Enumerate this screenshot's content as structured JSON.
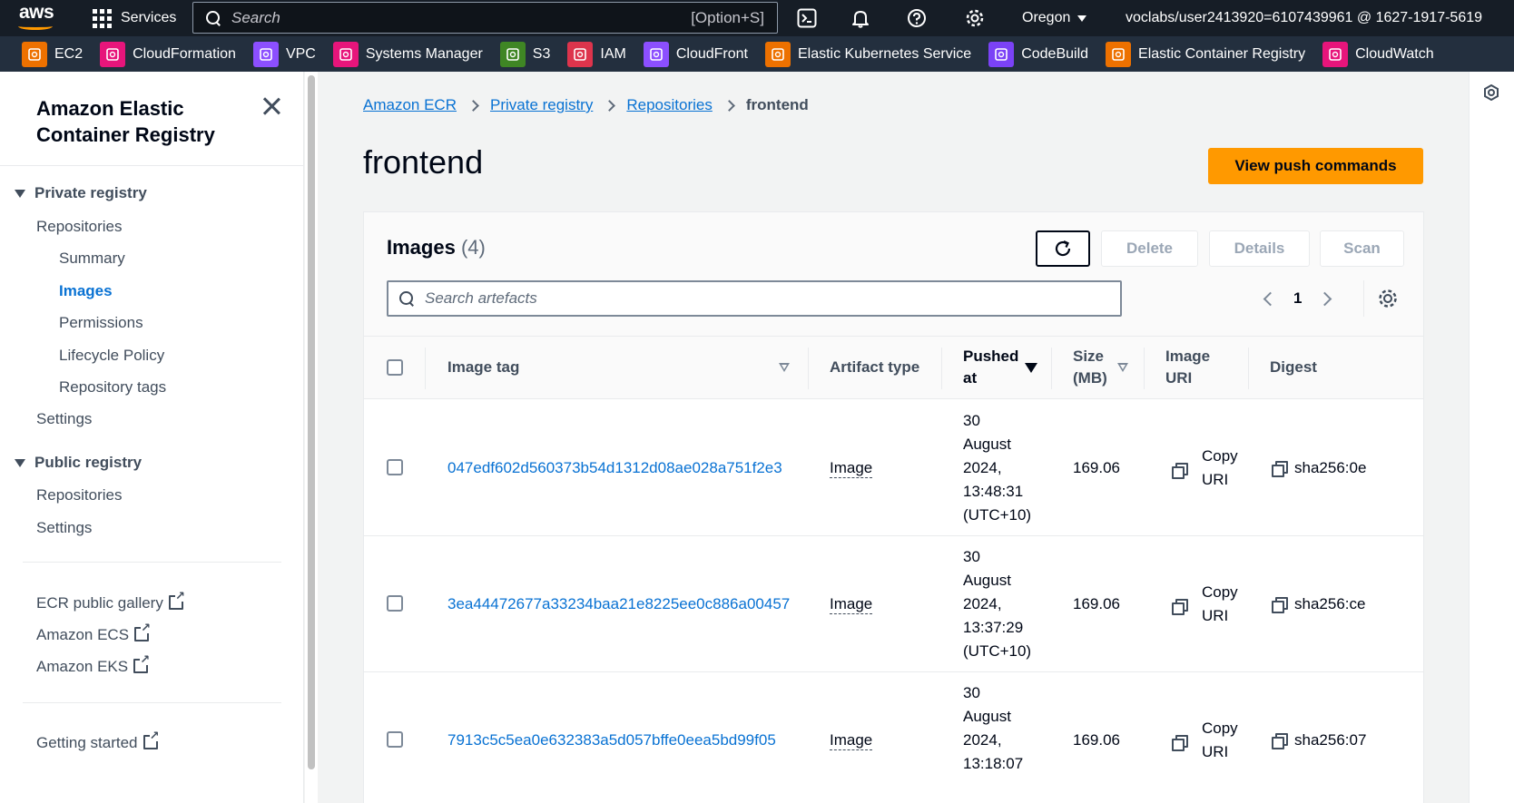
{
  "topnav": {
    "logo": "aws",
    "services_label": "Services",
    "search_placeholder": "Search",
    "search_shortcut": "[Option+S]",
    "region": "Oregon",
    "account": "voclabs/user2413920=6107439961 @ 1627-1917-5619",
    "icons": [
      "cloudshell-icon",
      "bell-icon",
      "help-icon",
      "gear-icon"
    ]
  },
  "favorites": [
    {
      "label": "EC2",
      "color": "#ed7100",
      "icon": "ec2-icon"
    },
    {
      "label": "CloudFormation",
      "color": "#e7157b",
      "icon": "cloudformation-icon"
    },
    {
      "label": "VPC",
      "color": "#8c4fff",
      "icon": "vpc-icon"
    },
    {
      "label": "Systems Manager",
      "color": "#e7157b",
      "icon": "systems-manager-icon"
    },
    {
      "label": "S3",
      "color": "#3f8624",
      "icon": "s3-icon"
    },
    {
      "label": "IAM",
      "color": "#dd344c",
      "icon": "iam-icon"
    },
    {
      "label": "CloudFront",
      "color": "#8c4fff",
      "icon": "cloudfront-icon"
    },
    {
      "label": "Elastic Kubernetes Service",
      "color": "#ed7100",
      "icon": "eks-icon"
    },
    {
      "label": "CodeBuild",
      "color": "#7b42f6",
      "icon": "codebuild-icon"
    },
    {
      "label": "Elastic Container Registry",
      "color": "#ed7100",
      "icon": "ecr-icon"
    },
    {
      "label": "CloudWatch",
      "color": "#e7157b",
      "icon": "cloudwatch-icon"
    }
  ],
  "sidenav": {
    "title": "Amazon Elastic Container Registry",
    "private_registry": "Private registry",
    "private_items": {
      "repositories": "Repositories",
      "summary": "Summary",
      "images": "Images",
      "permissions": "Permissions",
      "lifecycle": "Lifecycle Policy",
      "repo_tags": "Repository tags",
      "settings": "Settings"
    },
    "public_registry": "Public registry",
    "public_items": {
      "repositories": "Repositories",
      "settings": "Settings"
    },
    "external": {
      "gallery": "ECR public gallery",
      "ecs": "Amazon ECS",
      "eks": "Amazon EKS"
    },
    "getting_started": "Getting started"
  },
  "breadcrumb": {
    "root": "Amazon ECR",
    "registry": "Private registry",
    "repositories": "Repositories",
    "current": "frontend"
  },
  "page": {
    "title": "frontend",
    "push_button": "View push commands"
  },
  "images_panel": {
    "title": "Images",
    "count": "(4)",
    "buttons": {
      "delete": "Delete",
      "details": "Details",
      "scan": "Scan"
    },
    "search_placeholder": "Search artefacts",
    "page": "1",
    "columns": {
      "image_tag": "Image tag",
      "artifact_type": "Artifact type",
      "pushed_at_1": "Pushed",
      "pushed_at_2": "at",
      "size_1": "Size",
      "size_2": "(MB)",
      "uri_1": "Image",
      "uri_2": "URI",
      "digest": "Digest"
    },
    "rows": [
      {
        "tag": "047edf602d560373b54d1312d08ae028a751f2e3",
        "type": "Image",
        "pushed": [
          "30",
          "August",
          "2024,",
          "13:48:31",
          "(UTC+10)"
        ],
        "size": "169.06",
        "uri_1": "Copy",
        "uri_2": "URI",
        "digest": "sha256:0e"
      },
      {
        "tag": "3ea44472677a33234baa21e8225ee0c886a00457",
        "type": "Image",
        "pushed": [
          "30",
          "August",
          "2024,",
          "13:37:29",
          "(UTC+10)"
        ],
        "size": "169.06",
        "uri_1": "Copy",
        "uri_2": "URI",
        "digest": "sha256:ce"
      },
      {
        "tag": "7913c5c5ea0e632383a5d057bffe0eea5bd99f05",
        "type": "Image",
        "pushed": [
          "30",
          "August",
          "2024,",
          "13:18:07"
        ],
        "size": "169.06",
        "uri_1": "Copy",
        "uri_2": "URI",
        "digest": "sha256:07"
      }
    ]
  }
}
